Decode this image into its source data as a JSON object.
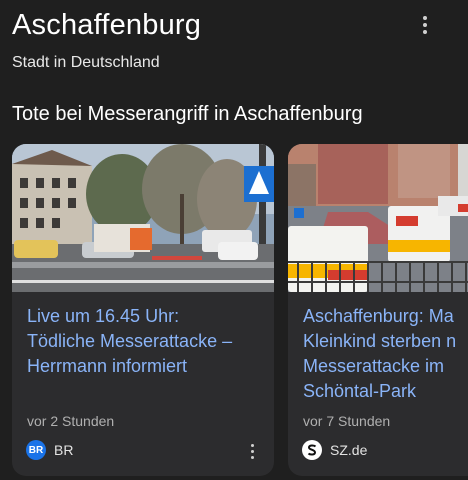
{
  "header": {
    "title": "Aschaffenburg",
    "subtitle": "Stadt in Deutschland"
  },
  "section": {
    "title": "Tote bei Messerangriff in Aschaffenburg"
  },
  "cards": [
    {
      "headline_lines": [
        "Live um 16.45 Uhr:",
        "Tödliche Messerattacke –",
        "Herrmann informiert"
      ],
      "time": "vor 2 Stunden",
      "source_logo": "BR",
      "source_logo_color": "#1a73e8",
      "source": "BR"
    },
    {
      "headline_lines": [
        "Aschaffenburg: Ma",
        "Kleinkind sterben n",
        "Messerattacke im",
        "Schöntal-Park"
      ],
      "time": "vor 7 Stunden",
      "source_logo": "S",
      "source_logo_color": "#ffffff",
      "source": "SZ.de"
    }
  ],
  "colors": {
    "background": "#1f1f1f",
    "card": "#2c2c2e",
    "link": "#8ab4f8"
  }
}
